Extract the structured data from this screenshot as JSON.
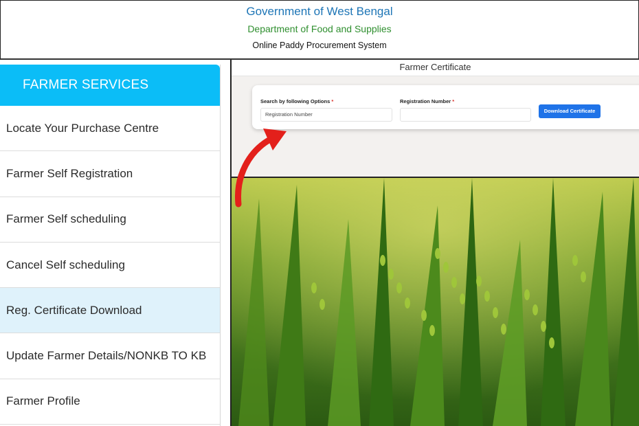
{
  "header": {
    "gov": "Government of West Bengal",
    "dept": "Department of Food and Supplies",
    "system": "Online Paddy Procurement System"
  },
  "sidebar": {
    "title": "FARMER SERVICES",
    "items": [
      {
        "label": "Locate Your Purchase Centre"
      },
      {
        "label": "Farmer Self Registration"
      },
      {
        "label": "Farmer Self scheduling"
      },
      {
        "label": "Cancel Self scheduling"
      },
      {
        "label": "Reg. Certificate Download"
      },
      {
        "label": "Update Farmer Details/NONKB TO KB"
      },
      {
        "label": "Farmer Profile"
      }
    ],
    "active_index": 4
  },
  "certificate": {
    "title": "Farmer Certificate",
    "search_label": "Search by following Options",
    "search_value": "Registration Number",
    "reg_label": "Registration Number",
    "reg_value": "",
    "required_mark": "*",
    "download_button": "Download Certificate"
  },
  "colors": {
    "sidebar_header": "#0bbdf7",
    "active_item": "#dff2fb",
    "button": "#1f73e8",
    "arrow": "#e3201b",
    "gov_title": "#1d75b6",
    "dept_title": "#2f8f2f"
  }
}
